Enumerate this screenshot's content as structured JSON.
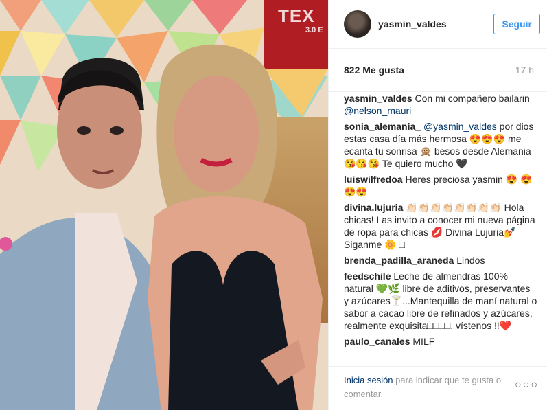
{
  "post": {
    "username": "yasmin_valdes",
    "follow_label": "Seguir",
    "likes": "822 Me gusta",
    "time": "17 h"
  },
  "comments": [
    {
      "user": "yasmin_valdes",
      "text": "Con mi compañero bailarin ",
      "mention": "@nelson_mauri",
      "after": ""
    },
    {
      "user": "sonia_alemania_",
      "text": "",
      "mention": "@yasmin_valdes",
      "after": " por dios estas casa día más hermosa 😍😍😍 me ecanta tu sonrisa 🙊 besos desde Alemania 😘😘😘 Te quiero mucho 🖤"
    },
    {
      "user": "luiswilfredoa",
      "text": "Heres preciosa yasmin 😍 😍😍😍",
      "mention": "",
      "after": ""
    },
    {
      "user": "divina.lujuria",
      "text": "👏🏻👏🏻👏🏻👏🏻👏🏻👏🏻👏🏻👏🏻 Hola chicas! Las invito a conocer mi nueva página de ropa para chicas 💋 Divina Lujuria💅 Siganme 🌼 □",
      "mention": "",
      "after": ""
    },
    {
      "user": "brenda_padilla_araneda",
      "text": "Lindos",
      "mention": "",
      "after": ""
    },
    {
      "user": "feedschile",
      "text": "Leche de almendras 100% natural 💚🌿 libre de aditivos, preservantes y azúcares🍸...Mantequilla de maní natural o sabor a cacao libre de refinados y azúcares, realmente exquisita□□□□, vístenos !!❤️",
      "mention": "",
      "after": ""
    },
    {
      "user": "paulo_canales",
      "text": "MILF",
      "mention": "",
      "after": ""
    }
  ],
  "footer": {
    "login_link": "Inicia sesión",
    "rest": " para indicar que te gusta o comentar.",
    "more_label": "○○○"
  },
  "screen": {
    "text": "TEX",
    "sub": "3.0 E"
  }
}
